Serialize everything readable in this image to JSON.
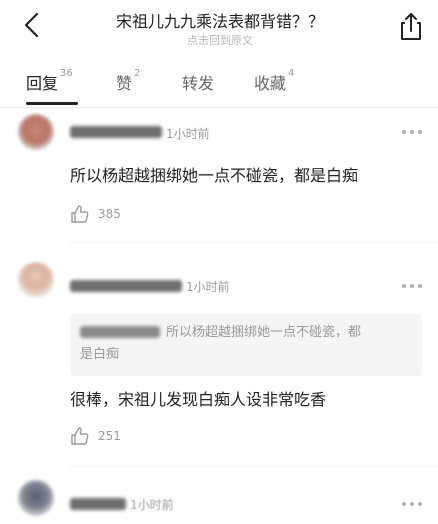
{
  "header": {
    "title": "宋祖儿九九乘法表都背错？？",
    "subtitle": "点击回到原文",
    "back_icon": "chevron-left-icon",
    "share_icon": "share-icon"
  },
  "tabs": [
    {
      "label": "回复",
      "count": "36",
      "active": true
    },
    {
      "label": "赞",
      "count": "2",
      "active": false
    },
    {
      "label": "转发",
      "count": "",
      "active": false
    },
    {
      "label": "收藏",
      "count": "4",
      "active": false
    }
  ],
  "comments": [
    {
      "time": "1小时前",
      "text": "所以杨超越捆绑她一点不碰瓷，都是白痴",
      "likes": "385"
    },
    {
      "time": "1小时前",
      "quote_line1": "所以杨超越捆绑她一点不碰瓷，都",
      "quote_line2": "是白痴",
      "text": "很棒，宋祖儿发现白痴人设非常吃香",
      "likes": "251"
    },
    {
      "time": "1小时前"
    }
  ],
  "colors": {
    "accent": "#222222",
    "muted": "#9a9a9a"
  }
}
